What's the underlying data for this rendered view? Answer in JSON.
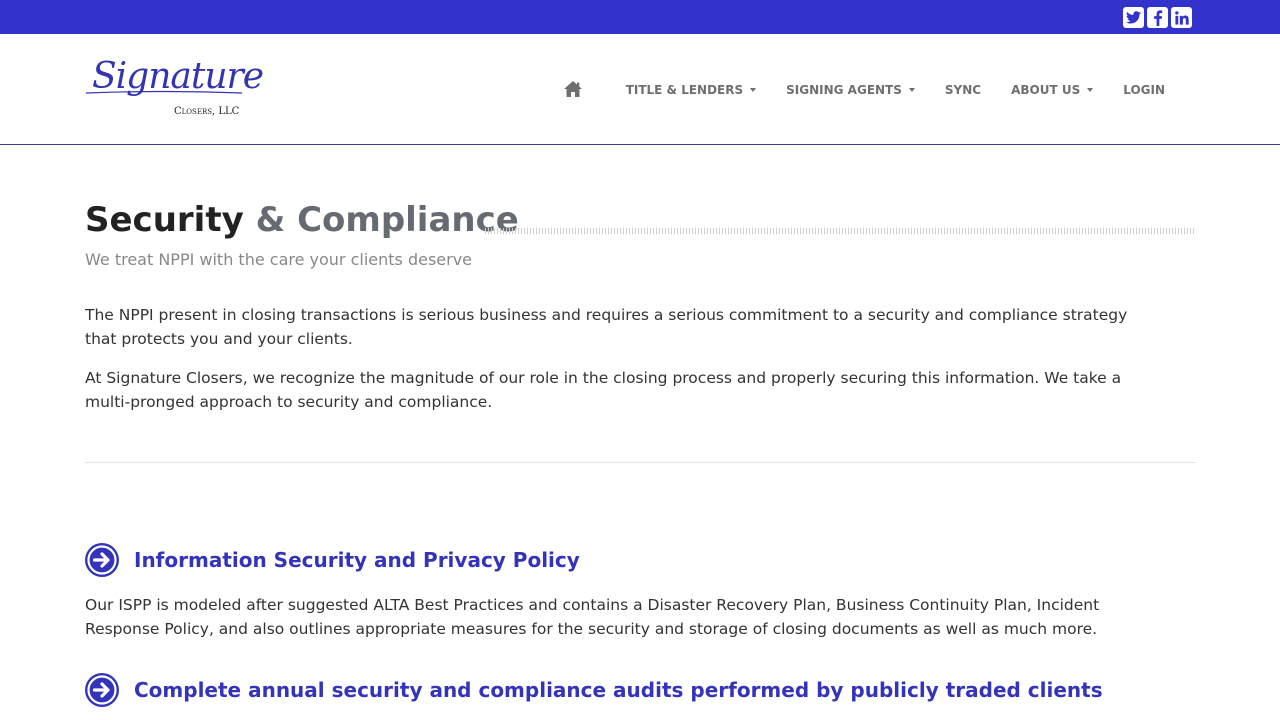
{
  "colors": {
    "topbar": "#3333cc",
    "accent": "#3333bb",
    "nav_text": "#6f6f6f",
    "header_border": "#3d3d8f"
  },
  "social": [
    {
      "icon": "twitter-icon"
    },
    {
      "icon": "facebook-icon"
    },
    {
      "icon": "linkedin-icon"
    }
  ],
  "logo": {
    "word": "Signature",
    "sub": "Closers, LLC"
  },
  "nav": {
    "home_icon": "home-icon",
    "items": [
      {
        "label": "TITLE & LENDERS",
        "dropdown": true
      },
      {
        "label": "SIGNING AGENTS",
        "dropdown": true
      },
      {
        "label": "SYNC",
        "dropdown": false
      },
      {
        "label": "ABOUT US",
        "dropdown": true
      },
      {
        "label": "LOGIN",
        "dropdown": false
      }
    ]
  },
  "page": {
    "title_strong": "Security",
    "title_light": " & Compliance",
    "subtitle": "We treat NPPI with the care your clients deserve",
    "paragraphs": [
      "The NPPI present in closing transactions is serious business and requires a serious commitment to a security and compliance strategy that protects you and your clients.",
      "At Signature Closers, we recognize the magnitude of our role in the closing process and properly securing this information. We take a multi-pronged approach to security and compliance."
    ]
  },
  "features": [
    {
      "icon": "arrow-right-circle-icon",
      "title": "Information Security and Privacy Policy",
      "text": "Our ISPP is modeled after suggested ALTA Best Practices and contains a Disaster Recovery Plan, Business Continuity Plan, Incident Response Policy, and also outlines appropriate measures for the security and storage of closing documents as well as much more."
    },
    {
      "icon": "arrow-right-circle-icon",
      "title": "Complete annual security and compliance audits performed by publicly traded clients"
    }
  ]
}
